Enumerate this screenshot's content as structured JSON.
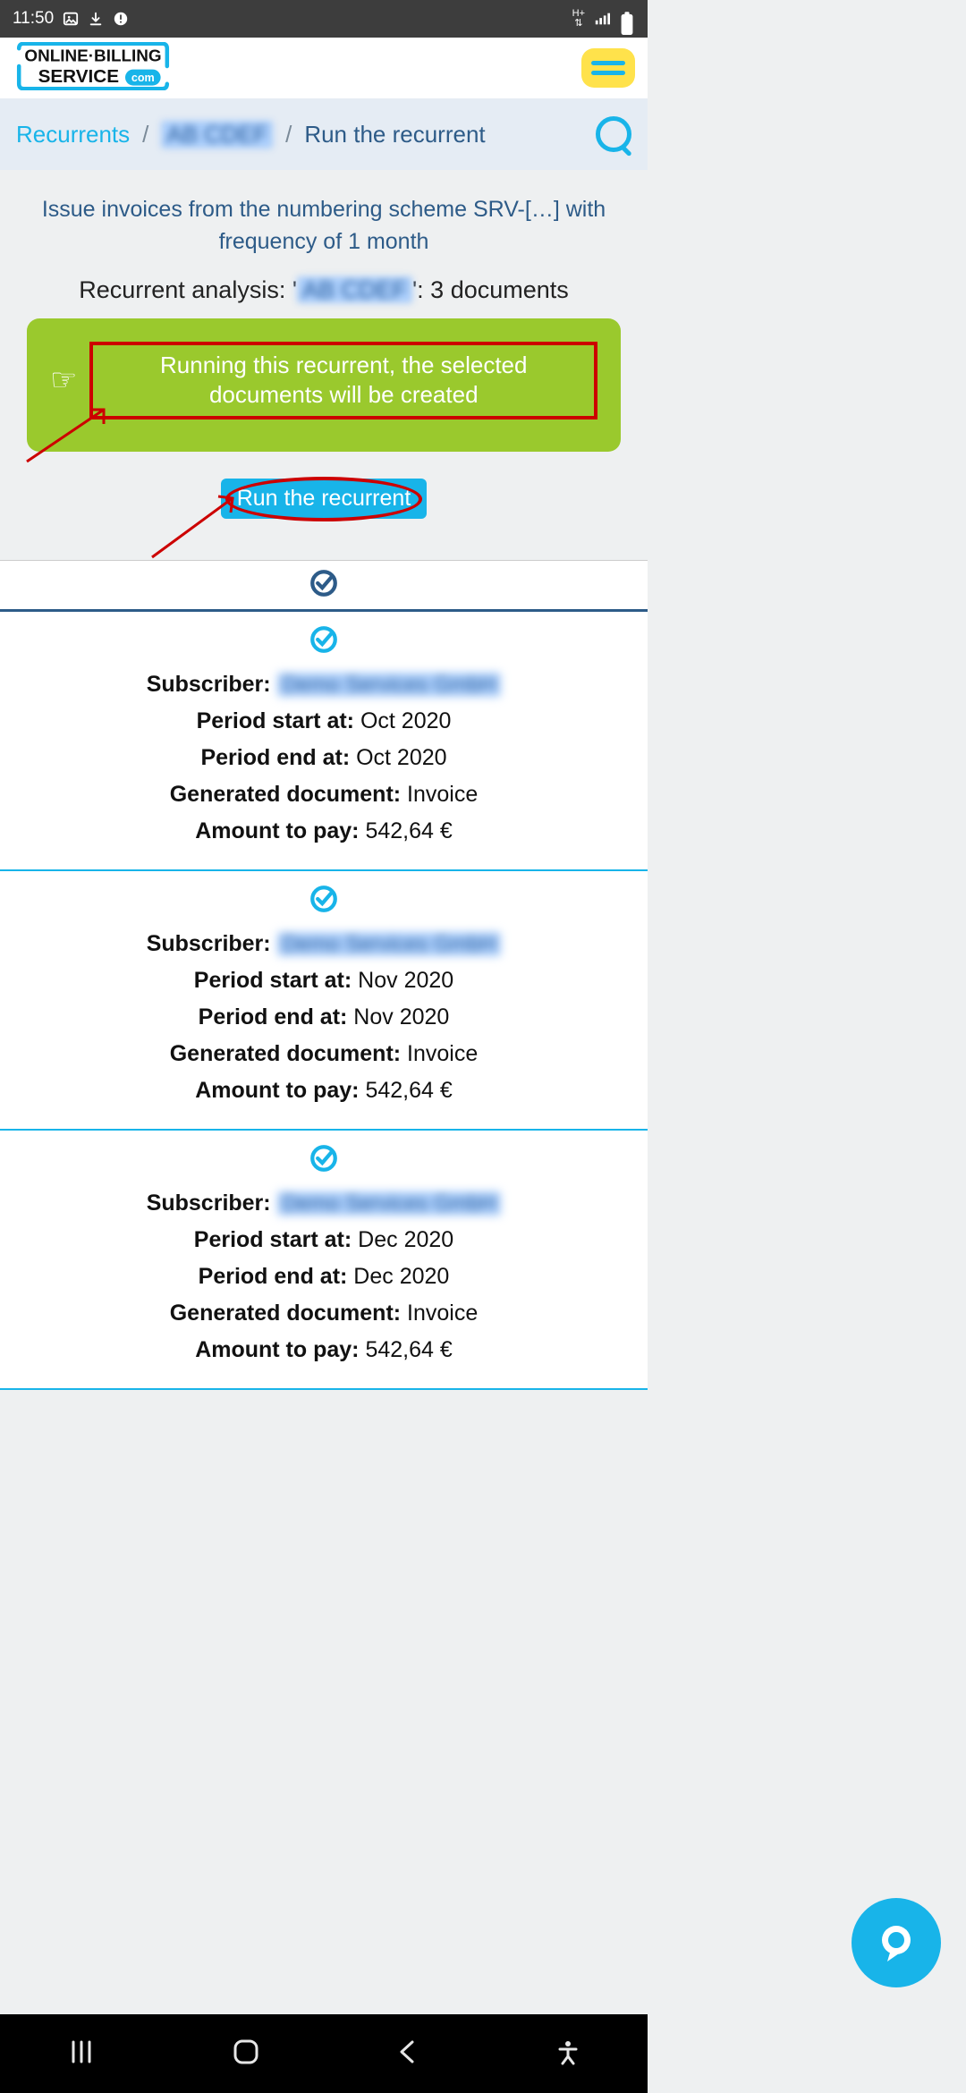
{
  "status": {
    "time": "11:50"
  },
  "logo": {
    "line1": "ONLINE·BILLING",
    "line2": "SERVICE",
    "badge": "com"
  },
  "breadcrumb": {
    "item1": "Recurrents",
    "item2_blurred": "AB  CDEF",
    "item3": "Run the recurrent"
  },
  "intro": {
    "text": "Issue invoices from the numbering scheme SRV-[…] with frequency of 1 month"
  },
  "analysis": {
    "prefix": "Recurrent analysis: '",
    "blurred": "AB  CDEF",
    "suffix": "': 3 documents"
  },
  "alert": {
    "msg": "Running this recurrent, the selected documents will be created"
  },
  "run_button": {
    "label": "Run the recurrent"
  },
  "labels": {
    "subscriber": "Subscriber:",
    "period_start": "Period start at:",
    "period_end": "Period end at:",
    "generated": "Generated document:",
    "amount": "Amount to pay:"
  },
  "cards": [
    {
      "subscriber_blurred": "Demo Services GmbH",
      "period_start": "Oct 2020",
      "period_end": "Oct 2020",
      "generated": "Invoice",
      "amount": "542,64 €"
    },
    {
      "subscriber_blurred": "Demo Services GmbH",
      "period_start": "Nov 2020",
      "period_end": "Nov 2020",
      "generated": "Invoice",
      "amount": "542,64 €"
    },
    {
      "subscriber_blurred": "Demo Services GmbH",
      "period_start": "Dec 2020",
      "period_end": "Dec 2020",
      "generated": "Invoice",
      "amount": "542,64 €"
    }
  ]
}
